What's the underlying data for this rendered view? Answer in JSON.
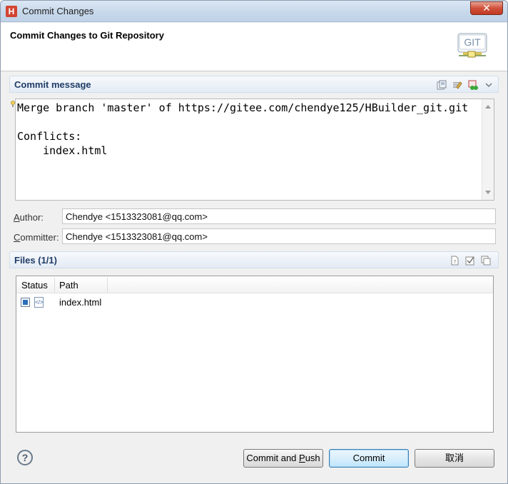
{
  "window": {
    "app_icon_letter": "H",
    "title": "Commit Changes",
    "close_symbol": "✕"
  },
  "header": {
    "title": "Commit Changes to Git Repository",
    "logo_text": "GIT"
  },
  "commit_message": {
    "section_title": "Commit message",
    "text": "Merge branch 'master' of https://gitee.com/chendye125/HBuilder_git.git\n\nConflicts:\n    index.html"
  },
  "author": {
    "label_first": "A",
    "label_rest": "uthor:",
    "value": "Chendye <1513323081@qq.com>"
  },
  "committer": {
    "label_first": "C",
    "label_rest": "ommitter:",
    "value": "Chendye <1513323081@qq.com>"
  },
  "files": {
    "section_title": "Files (1/1)",
    "columns": [
      "Status",
      "Path"
    ],
    "rows": [
      {
        "checked": true,
        "path": "index.html"
      }
    ]
  },
  "footer": {
    "help_symbol": "?",
    "commit_and_push_prefix": "Commit and ",
    "commit_and_push_mnemonic": "P",
    "commit_and_push_suffix": "ush",
    "commit_label": "Commit",
    "cancel_label": "取消"
  }
}
